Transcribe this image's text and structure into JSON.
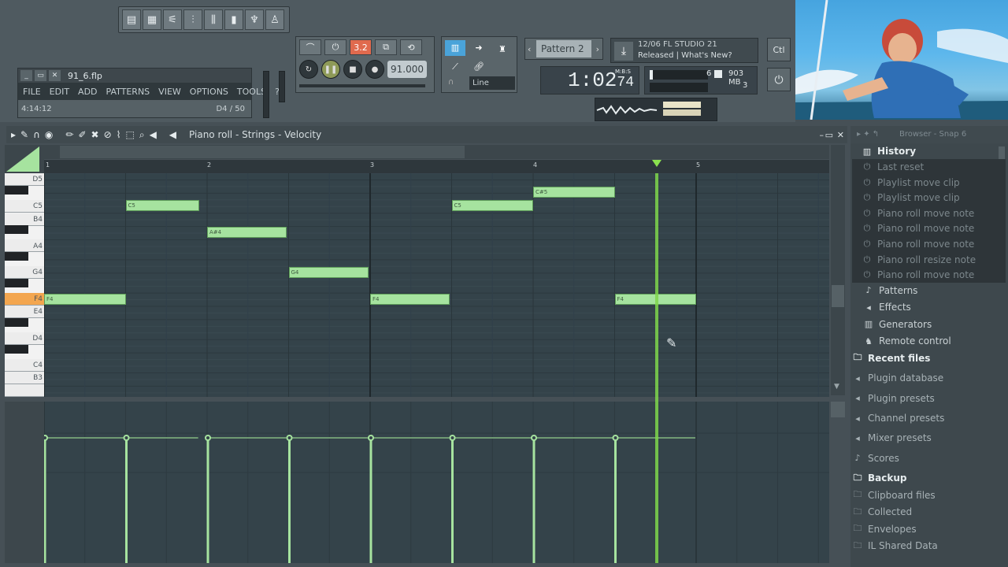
{
  "toolbar_icons": [
    "playlist-icon",
    "piano-roll-icon",
    "channel-rack-icon",
    "mixer-icon",
    "plugin-icon",
    "browser-icon",
    "recorder-icon",
    "figure-icon"
  ],
  "mini_window": {
    "filename": "91_6.flp",
    "menu": [
      "FILE",
      "EDIT",
      "ADD",
      "PATTERNS",
      "VIEW",
      "OPTIONS",
      "TOOLS",
      "?"
    ],
    "time": "4:14:12",
    "position": "D4 / 50"
  },
  "transport": {
    "pat_label": "3.2",
    "tempo": "91.000"
  },
  "snap": {
    "mode": "Line"
  },
  "pattern": {
    "label": "Pattern 2"
  },
  "news": {
    "line1": "12/06  FL STUDIO 21",
    "line2": "Released | What's New?"
  },
  "time_display": {
    "value": "1:02",
    "sub": "74",
    "unit": "M:B:S"
  },
  "cpu": {
    "voices": "6",
    "memory": "903 MB",
    "polyphony": "3"
  },
  "ctl_label": "Ctl",
  "piano_roll": {
    "breadcrumb": "Piano roll - Strings - Velocity",
    "ruler": [
      "1",
      "2",
      "3",
      "4",
      "5"
    ],
    "key_labels": [
      "D5",
      "C5",
      "B4",
      "A4",
      "G4",
      "F4",
      "E4",
      "D4",
      "C4",
      "B3"
    ],
    "notes": [
      {
        "label": "F4",
        "start": 0,
        "len": 1,
        "row": "F4"
      },
      {
        "label": "C5",
        "start": 1,
        "len": 0.9,
        "row": "C5"
      },
      {
        "label": "A#4",
        "start": 2,
        "len": 0.98,
        "row": "A#4"
      },
      {
        "label": "G4",
        "start": 3,
        "len": 0.98,
        "row": "G4"
      },
      {
        "label": "F4",
        "start": 4,
        "len": 0.98,
        "row": "F4"
      },
      {
        "label": "C5",
        "start": 5,
        "len": 1,
        "row": "C5"
      },
      {
        "label": "C#5",
        "start": 6,
        "len": 1,
        "row": "C#5"
      },
      {
        "label": "F4",
        "start": 7,
        "len": 1,
        "row": "F4"
      }
    ],
    "velocity": [
      0.78,
      0.78,
      0.78,
      0.78,
      0.78,
      0.78,
      0.78,
      0.78
    ]
  },
  "browser": {
    "header": "Browser - Snap 6",
    "history_title": "History",
    "history": [
      "Last reset",
      "Playlist move clip",
      "Playlist move clip",
      "Piano roll move note",
      "Piano roll move note",
      "Piano roll move note",
      "Piano roll resize note",
      "Piano roll move note"
    ],
    "current": [
      "Patterns",
      "Effects",
      "Generators",
      "Remote control"
    ],
    "folders": [
      "Recent files",
      "Plugin database",
      "Plugin presets",
      "Channel presets",
      "Mixer presets",
      "Scores",
      "Backup",
      "Clipboard files",
      "Collected",
      "Envelopes",
      "IL Shared Data"
    ]
  }
}
